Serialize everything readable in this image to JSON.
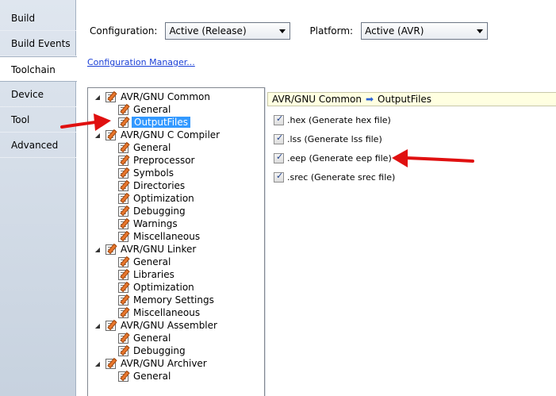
{
  "tabs": [
    {
      "label": "Build",
      "active": false
    },
    {
      "label": "Build Events",
      "active": false
    },
    {
      "label": "Toolchain",
      "active": true
    },
    {
      "label": "Device",
      "active": false
    },
    {
      "label": "Tool",
      "active": false
    },
    {
      "label": "Advanced",
      "active": false
    }
  ],
  "config": {
    "configuration_label": "Configuration:",
    "configuration_value": "Active (Release)",
    "platform_label": "Platform:",
    "platform_value": "Active (AVR)",
    "manager_link": "Configuration Manager..."
  },
  "tree": [
    {
      "label": "AVR/GNU Common",
      "level": 0,
      "expanded": true
    },
    {
      "label": "General",
      "level": 1
    },
    {
      "label": "OutputFiles",
      "level": 1,
      "selected": true
    },
    {
      "label": "AVR/GNU C Compiler",
      "level": 0,
      "expanded": true
    },
    {
      "label": "General",
      "level": 1
    },
    {
      "label": "Preprocessor",
      "level": 1
    },
    {
      "label": "Symbols",
      "level": 1
    },
    {
      "label": "Directories",
      "level": 1
    },
    {
      "label": "Optimization",
      "level": 1
    },
    {
      "label": "Debugging",
      "level": 1
    },
    {
      "label": "Warnings",
      "level": 1
    },
    {
      "label": "Miscellaneous",
      "level": 1
    },
    {
      "label": "AVR/GNU Linker",
      "level": 0,
      "expanded": true
    },
    {
      "label": "General",
      "level": 1
    },
    {
      "label": "Libraries",
      "level": 1
    },
    {
      "label": "Optimization",
      "level": 1
    },
    {
      "label": "Memory Settings",
      "level": 1
    },
    {
      "label": "Miscellaneous",
      "level": 1
    },
    {
      "label": "AVR/GNU Assembler",
      "level": 0,
      "expanded": true
    },
    {
      "label": "General",
      "level": 1
    },
    {
      "label": "Debugging",
      "level": 1
    },
    {
      "label": "AVR/GNU Archiver",
      "level": 0,
      "expanded": true
    },
    {
      "label": "General",
      "level": 1
    }
  ],
  "breadcrumb": {
    "parent": "AVR/GNU Common",
    "child": "OutputFiles"
  },
  "options": [
    {
      "label": ".hex (Generate hex file)",
      "checked": true
    },
    {
      "label": ".lss (Generate lss file)",
      "checked": true
    },
    {
      "label": ".eep (Generate eep file)",
      "checked": true
    },
    {
      "label": ".srec (Generate srec file)",
      "checked": true
    }
  ],
  "colors": {
    "selection": "#3399ff",
    "annotation_arrow": "#e01010",
    "link": "#1a3fd6"
  }
}
